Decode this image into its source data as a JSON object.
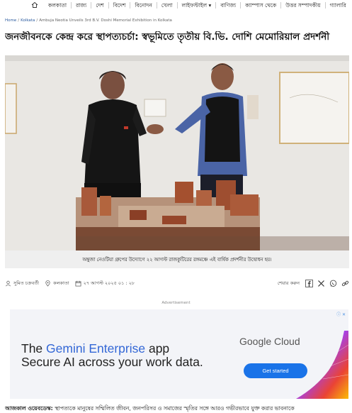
{
  "nav": {
    "items": [
      "কলকাতা",
      "রাজ্য",
      "দেশ",
      "বিদেশ",
      "বিনোদন",
      "খেলা",
      "লাইফস্টাইল ▾",
      "বাণিজ্য",
      "ক্যাম্পাস থেকে",
      "উত্তর সম্পাদকীয়",
      "গ্যালারি"
    ]
  },
  "breadcrumb": {
    "home": "Home",
    "section": "Kolkata",
    "current": "Ambuja Neotia Unveils 3rd B.V. Doshi Memorial Exhibition in Kolkata"
  },
  "article": {
    "headline": "জনজীবনকে কেন্দ্র করে স্থাপত্যচর্চা: স্বভূমিতে তৃতীয় বি.ভি. দোশি মেমোরিয়াল প্রদর্শনী",
    "caption": "অম্বুজা নেওটিয়া গ্রুপের উদ্যোগে ২২ আগস্ট রাজকুটিরের রঙ্গমঞ্চে এই বার্ষিক প্রদর্শনীর উদ্বোধন হয়।",
    "author": "সুমিত চক্রবর্তী",
    "location": "কলকাতা",
    "date": "২৭ আগস্ট ২০২৫ ০১ : ২৮",
    "share_label": "শেয়ার করুন",
    "body_lead": "আজকাল ওয়েবডেস্ক:",
    "body_text": " স্থাপত্যকে মানুষের সম্মিলিত জীবন, জনপরিসর ও সমাজের স্মৃতির সঙ্গে আরও গভীরভাবে যুক্ত করার ভাবনাকে"
  },
  "ad": {
    "label": "Advertisement",
    "line1_prefix": "The ",
    "line1_accent": "Gemini Enterprise",
    "line1_suffix": " app",
    "line2": "Secure AI across your work data.",
    "brand": "Google Cloud",
    "cta": "Get started",
    "colors": {
      "accent": "#3367d6",
      "cta": "#1a73e8"
    }
  }
}
